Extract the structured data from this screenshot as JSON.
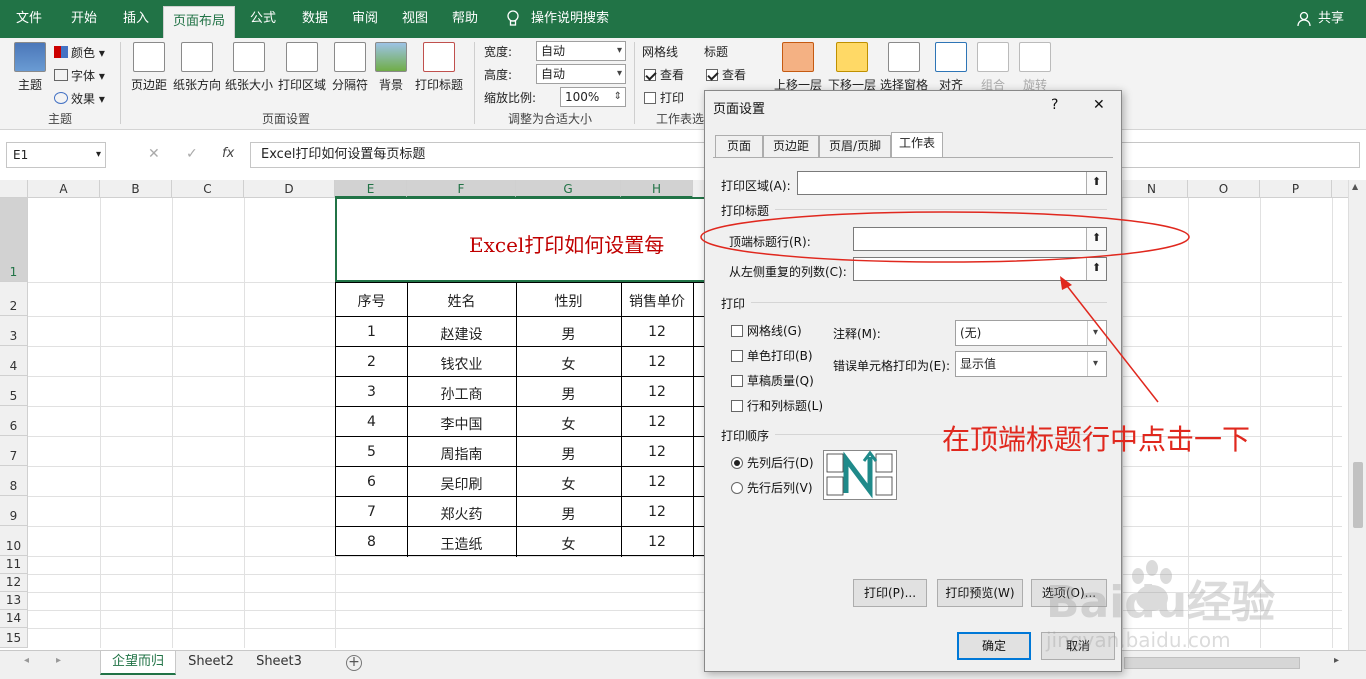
{
  "tabs": [
    "文件",
    "开始",
    "插入",
    "页面布局",
    "公式",
    "数据",
    "审阅",
    "视图",
    "帮助",
    "操作说明搜索"
  ],
  "tab_icons": {
    "search": "lightbulb-icon"
  },
  "share_label": "共享",
  "ribbon": {
    "theme": {
      "main": "主题",
      "colors": "颜色",
      "fonts": "字体",
      "effects": "效果",
      "group": "主题"
    },
    "page_setup": {
      "margins": "页边距",
      "orientation": "纸张方向",
      "size": "纸张大小",
      "print_area": "打印区域",
      "breaks": "分隔符",
      "background": "背景",
      "print_titles": "打印标题",
      "group": "页面设置"
    },
    "scale": {
      "width_label": "宽度:",
      "width_value": "自动",
      "height_label": "高度:",
      "height_value": "自动",
      "scale_label": "缩放比例:",
      "scale_value": "100%",
      "group": "调整为合适大小"
    },
    "sheet_options": {
      "gridlines": "网格线",
      "headings": "标题",
      "view": "查看",
      "print": "打印",
      "group": "工作表选"
    },
    "arrange": {
      "forward": "上移一层",
      "backward": "下移一层",
      "selection": "选择窗格",
      "align": "对齐",
      "group_btn": "组合",
      "rotate": "旋转"
    }
  },
  "formula_bar": {
    "name_box": "E1",
    "fx": "fx",
    "formula": "Excel打印如何设置每页标题"
  },
  "columns": [
    "A",
    "B",
    "C",
    "D",
    "E",
    "F",
    "G",
    "H",
    "N",
    "O",
    "P"
  ],
  "rows": [
    "1",
    "2",
    "3",
    "4",
    "5",
    "6",
    "7",
    "8",
    "9",
    "10",
    "11",
    "12",
    "13",
    "14",
    "15"
  ],
  "sheet_title": "Excel打印如何设置每",
  "table": {
    "headers": [
      "序号",
      "姓名",
      "性别",
      "销售单价"
    ],
    "rows": [
      [
        "1",
        "赵建设",
        "男",
        "12"
      ],
      [
        "2",
        "钱农业",
        "女",
        "12"
      ],
      [
        "3",
        "孙工商",
        "男",
        "12"
      ],
      [
        "4",
        "李中国",
        "女",
        "12"
      ],
      [
        "5",
        "周指南",
        "男",
        "12"
      ],
      [
        "6",
        "吴印刷",
        "女",
        "12"
      ],
      [
        "7",
        "郑火药",
        "男",
        "12"
      ],
      [
        "8",
        "王造纸",
        "女",
        "12"
      ]
    ]
  },
  "sheets": [
    "企望而归",
    "Sheet2",
    "Sheet3"
  ],
  "dialog": {
    "title": "页面设置",
    "help": "?",
    "close": "✕",
    "tabs": [
      "页面",
      "页边距",
      "页眉/页脚",
      "工作表"
    ],
    "print_area_label": "打印区域(A):",
    "print_titles_section": "打印标题",
    "rows_repeat_label": "顶端标题行(R):",
    "cols_repeat_label": "从左侧重复的列数(C):",
    "print_section": "打印",
    "gridlines": "网格线(G)",
    "mono": "单色打印(B)",
    "draft": "草稿质量(Q)",
    "row_col_headings": "行和列标题(L)",
    "comments_label": "注释(M):",
    "comments_value": "(无)",
    "errors_label": "错误单元格打印为(E):",
    "errors_value": "显示值",
    "order_section": "打印顺序",
    "down_then_over": "先列后行(D)",
    "over_then_down": "先行后列(V)",
    "btn_print": "打印(P)...",
    "btn_preview": "打印预览(W)",
    "btn_options": "选项(O)...",
    "btn_ok": "确定",
    "btn_cancel": "取消"
  },
  "annotation": "在顶端标题行中点击一下",
  "watermark": {
    "brand": "Baidu经验",
    "url": "jingyan.baidu.com"
  },
  "colors": {
    "excel_green": "#217346",
    "annotation_red": "#e0281e",
    "ribbon_bg": "#f3f3f3"
  }
}
